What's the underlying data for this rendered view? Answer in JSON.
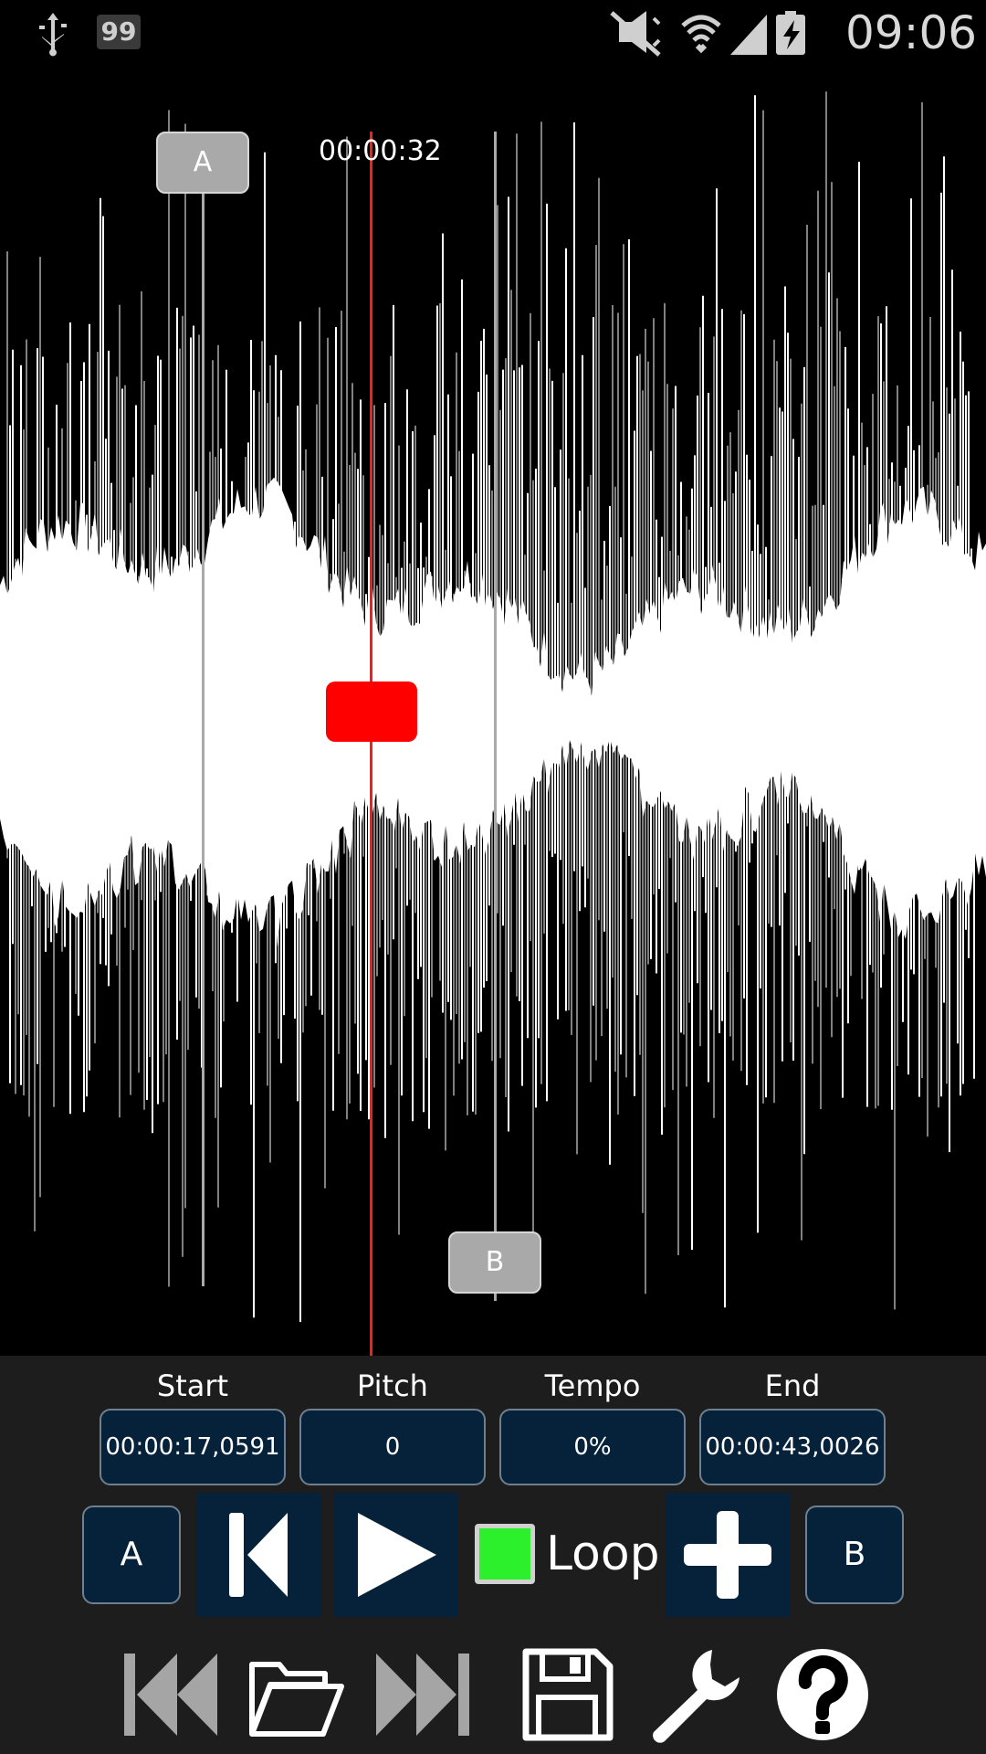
{
  "status_bar": {
    "notification_badge": "99",
    "time": "09:06",
    "icons": [
      "usb-icon",
      "notification-badge",
      "mute-icon",
      "wifi-icon",
      "signal-icon",
      "battery-charging-icon"
    ]
  },
  "waveform": {
    "position_time": "00:00:32",
    "marker_a_label": "A",
    "marker_b_label": "B",
    "colors": {
      "wave": "#ffffff",
      "playhead": "#ff0000",
      "markers": "#a9a9a9"
    }
  },
  "fields": {
    "start": {
      "label": "Start",
      "value": "00:00:17,0591"
    },
    "pitch": {
      "label": "Pitch",
      "value": "0"
    },
    "tempo": {
      "label": "Tempo",
      "value": "0%"
    },
    "end": {
      "label": "End",
      "value": "00:00:43,0026"
    }
  },
  "controls": {
    "set_a_label": "A",
    "set_b_label": "B",
    "loop_label": "Loop",
    "loop_checked": true
  },
  "toolbar": [
    "previous-track-icon",
    "open-folder-icon",
    "next-track-icon",
    "save-icon",
    "wrench-icon",
    "help-icon"
  ],
  "colors": {
    "panel_bg": "#1d1d1d",
    "field_bg": "#05223a",
    "loop_green": "#2cf02c"
  }
}
